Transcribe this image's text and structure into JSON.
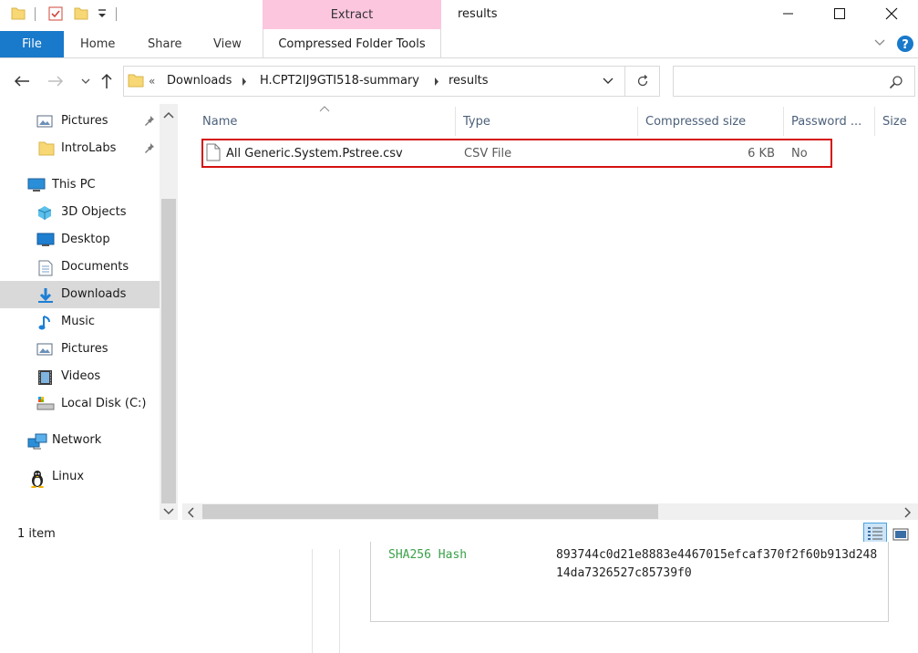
{
  "window": {
    "title": "results",
    "context_tab": "Extract"
  },
  "ribbon": {
    "tabs": {
      "file": "File",
      "home": "Home",
      "share": "Share",
      "view": "View",
      "compressed": "Compressed Folder Tools"
    }
  },
  "address": {
    "overflow": "«",
    "crumbs": [
      "Downloads",
      "H.CPT2IJ9GTI518-summary",
      "results"
    ],
    "search_placeholder": ""
  },
  "nav": {
    "items": [
      {
        "label": "Pictures",
        "icon": "pictures-icon",
        "pinned": true
      },
      {
        "label": "IntroLabs",
        "icon": "folder-icon",
        "pinned": true
      },
      {
        "label": "This PC",
        "icon": "computer-icon"
      },
      {
        "label": "3D Objects",
        "icon": "3d-objects-icon"
      },
      {
        "label": "Desktop",
        "icon": "desktop-icon"
      },
      {
        "label": "Documents",
        "icon": "documents-icon"
      },
      {
        "label": "Downloads",
        "icon": "downloads-icon",
        "selected": true
      },
      {
        "label": "Music",
        "icon": "music-icon"
      },
      {
        "label": "Pictures",
        "icon": "pictures-icon"
      },
      {
        "label": "Videos",
        "icon": "videos-icon"
      },
      {
        "label": "Local Disk (C:)",
        "icon": "local-disk-icon"
      },
      {
        "label": "Network",
        "icon": "network-icon"
      },
      {
        "label": "Linux",
        "icon": "linux-icon"
      }
    ]
  },
  "filelist": {
    "columns": [
      "Name",
      "Type",
      "Compressed size",
      "Password ...",
      "Size"
    ],
    "rows": [
      {
        "name": "All Generic.System.Pstree.csv",
        "type": "CSV File",
        "compressed_size": "6 KB",
        "password": "No",
        "icon": "csv-file-icon"
      }
    ]
  },
  "status": {
    "item_count": "1 item"
  },
  "background": {
    "hash_label": "SHA256 Hash",
    "hash_value": "893744c0d21e8883e4467015efcaf370f2f60b913d24814da7326527c85739f0"
  },
  "colors": {
    "file_tab": "#1979ca",
    "context_tab": "#fcc6df",
    "highlight_border": "#d40f0f",
    "hash_label": "#3aa14a"
  }
}
